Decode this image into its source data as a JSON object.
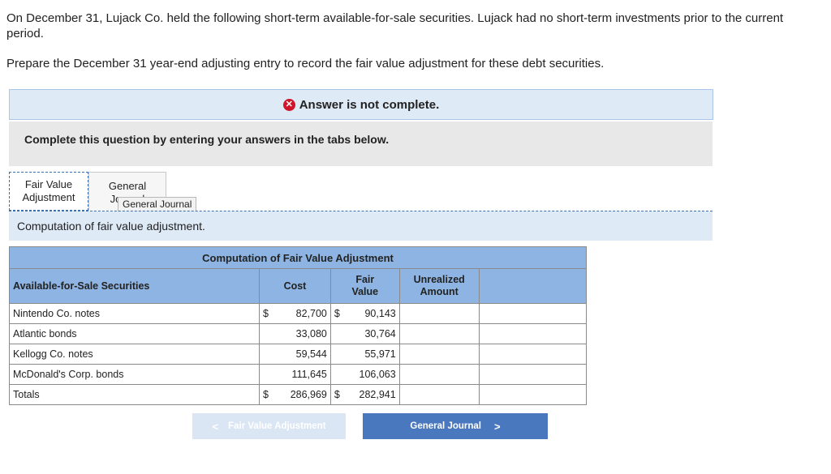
{
  "question": {
    "line1": "On December 31, Lujack Co. held the following short-term available-for-sale securities. Lujack had no short-term investments prior to the current period.",
    "line2": "Prepare the December 31 year-end adjusting entry to record the fair value adjustment for these debt securities."
  },
  "banner": {
    "text": "Answer is not complete.",
    "status_color": "#d0152a"
  },
  "instruction": "Complete this question by entering your answers in the tabs below.",
  "tabs": [
    {
      "label": "Fair Value Adjustment",
      "active": true
    },
    {
      "label": "General Journal",
      "active": false
    }
  ],
  "tooltip": "General Journal",
  "subtab_title": "Computation of fair value adjustment.",
  "table": {
    "caption": "Computation of Fair Value Adjustment",
    "headers": {
      "securities": "Available-for-Sale Securities",
      "cost": "Cost",
      "fair_value": "Fair Value",
      "unrealized": "Unrealized Amount"
    },
    "rows": [
      {
        "name": "Nintendo Co. notes",
        "cost_prefix": "$",
        "cost": "82,700",
        "fv_prefix": "$",
        "fv": "90,143",
        "unrealized": ""
      },
      {
        "name": "Atlantic bonds",
        "cost_prefix": "",
        "cost": "33,080",
        "fv_prefix": "",
        "fv": "30,764",
        "unrealized": ""
      },
      {
        "name": "Kellogg Co. notes",
        "cost_prefix": "",
        "cost": "59,544",
        "fv_prefix": "",
        "fv": "55,971",
        "unrealized": ""
      },
      {
        "name": "McDonald's Corp. bonds",
        "cost_prefix": "",
        "cost": "111,645",
        "fv_prefix": "",
        "fv": "106,063",
        "unrealized": ""
      },
      {
        "name": "Totals",
        "cost_prefix": "$",
        "cost": "286,969",
        "fv_prefix": "$",
        "fv": "282,941",
        "unrealized": ""
      }
    ]
  },
  "nav": {
    "prev_label": "Fair Value Adjustment",
    "next_label": "General Journal"
  },
  "colors": {
    "header_blue": "#8db4e2",
    "banner_bg": "#dfeaf7",
    "next_btn": "#4a78bf"
  }
}
